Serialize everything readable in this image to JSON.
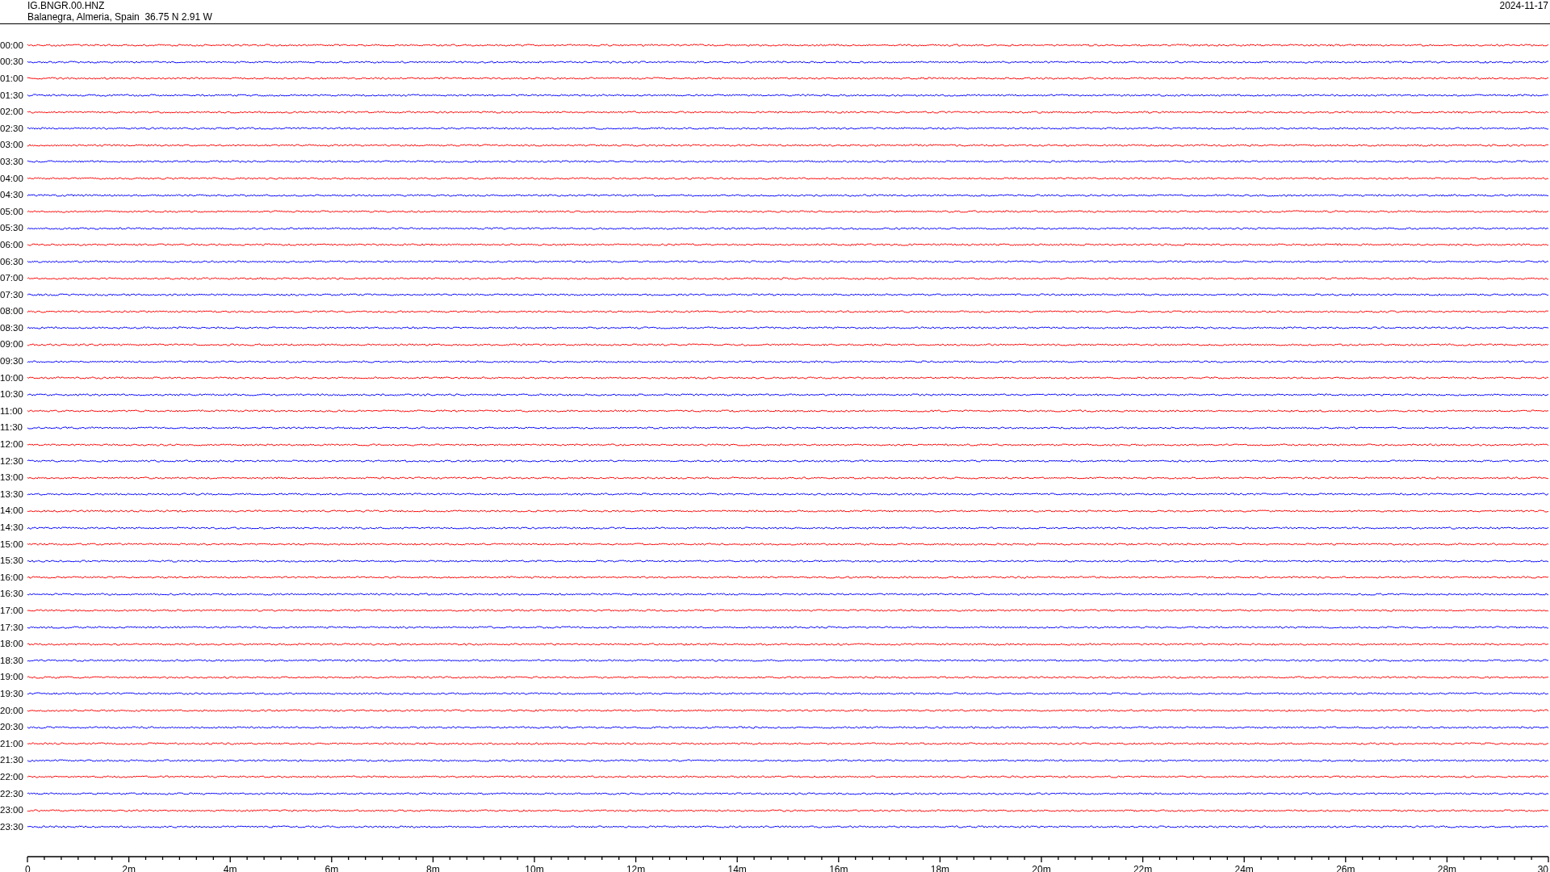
{
  "header": {
    "station": "IG.BNGR.00.HNZ",
    "location": "Balanegra, Almeria, Spain  36.75 N 2.91 W",
    "date": "2024-11-17"
  },
  "traces": [
    {
      "label": "00:00",
      "color": "#ff0000"
    },
    {
      "label": "00:30",
      "color": "#0000ff"
    },
    {
      "label": "01:00",
      "color": "#ff0000"
    },
    {
      "label": "01:30",
      "color": "#0000ff"
    },
    {
      "label": "02:00",
      "color": "#ff0000"
    },
    {
      "label": "02:30",
      "color": "#0000ff"
    },
    {
      "label": "03:00",
      "color": "#ff0000"
    },
    {
      "label": "03:30",
      "color": "#0000ff"
    },
    {
      "label": "04:00",
      "color": "#ff0000"
    },
    {
      "label": "04:30",
      "color": "#0000ff"
    },
    {
      "label": "05:00",
      "color": "#ff0000"
    },
    {
      "label": "05:30",
      "color": "#0000ff"
    },
    {
      "label": "06:00",
      "color": "#ff0000"
    },
    {
      "label": "06:30",
      "color": "#0000ff"
    },
    {
      "label": "07:00",
      "color": "#ff0000"
    },
    {
      "label": "07:30",
      "color": "#0000ff"
    },
    {
      "label": "08:00",
      "color": "#ff0000"
    },
    {
      "label": "08:30",
      "color": "#0000ff"
    },
    {
      "label": "09:00",
      "color": "#ff0000"
    },
    {
      "label": "09:30",
      "color": "#0000ff"
    },
    {
      "label": "10:00",
      "color": "#ff0000"
    },
    {
      "label": "10:30",
      "color": "#0000ff"
    },
    {
      "label": "11:00",
      "color": "#ff0000"
    },
    {
      "label": "11:30",
      "color": "#0000ff"
    },
    {
      "label": "12:00",
      "color": "#ff0000"
    },
    {
      "label": "12:30",
      "color": "#0000ff"
    },
    {
      "label": "13:00",
      "color": "#ff0000"
    },
    {
      "label": "13:30",
      "color": "#0000ff"
    },
    {
      "label": "14:00",
      "color": "#ff0000"
    },
    {
      "label": "14:30",
      "color": "#0000ff"
    },
    {
      "label": "15:00",
      "color": "#ff0000"
    },
    {
      "label": "15:30",
      "color": "#0000ff"
    },
    {
      "label": "16:00",
      "color": "#ff0000"
    },
    {
      "label": "16:30",
      "color": "#0000ff"
    },
    {
      "label": "17:00",
      "color": "#ff0000"
    },
    {
      "label": "17:30",
      "color": "#0000ff"
    },
    {
      "label": "18:00",
      "color": "#ff0000"
    },
    {
      "label": "18:30",
      "color": "#0000ff"
    },
    {
      "label": "19:00",
      "color": "#ff0000"
    },
    {
      "label": "19:30",
      "color": "#0000ff"
    },
    {
      "label": "20:00",
      "color": "#ff0000"
    },
    {
      "label": "20:30",
      "color": "#0000ff"
    },
    {
      "label": "21:00",
      "color": "#ff0000"
    },
    {
      "label": "21:30",
      "color": "#0000ff"
    },
    {
      "label": "22:00",
      "color": "#ff0000"
    },
    {
      "label": "22:30",
      "color": "#0000ff"
    },
    {
      "label": "23:00",
      "color": "#ff0000"
    },
    {
      "label": "23:30",
      "color": "#0000ff"
    }
  ],
  "x_axis": {
    "tick_labels": [
      "0",
      "2m",
      "4m",
      "6m",
      "8m",
      "10m",
      "12m",
      "14m",
      "16m",
      "18m",
      "20m",
      "22m",
      "24m",
      "26m",
      "28m",
      "30"
    ]
  }
}
